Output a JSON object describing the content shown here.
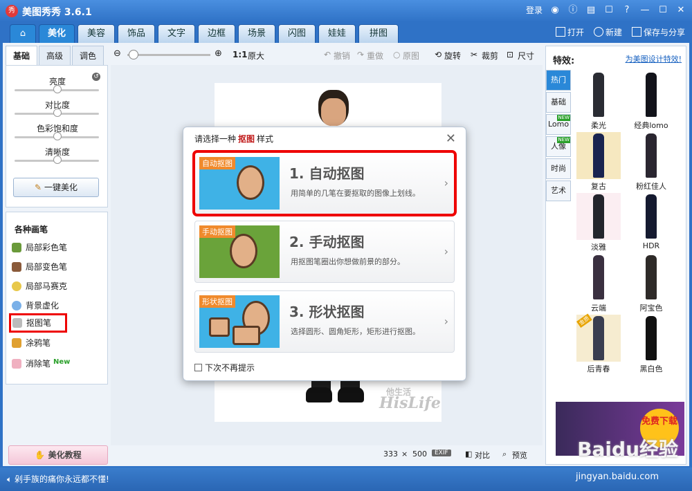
{
  "app": {
    "title": "美图秀秀 3.6.1",
    "logo_text": "秀"
  },
  "titlebar": {
    "login": "登录"
  },
  "tabs": [
    "美化",
    "美容",
    "饰品",
    "文字",
    "边框",
    "场景",
    "闪图",
    "娃娃",
    "拼图"
  ],
  "tab_actions": {
    "open": "打开",
    "new": "新建",
    "save": "保存与分享"
  },
  "left": {
    "subtabs": [
      "基础",
      "高级",
      "调色"
    ],
    "sliders": [
      {
        "label": "亮度",
        "value": 0.5
      },
      {
        "label": "对比度",
        "value": 0.5
      },
      {
        "label": "色彩饱和度",
        "value": 0.5
      },
      {
        "label": "清晰度",
        "value": 0.5
      }
    ],
    "oneclick": "一键美化",
    "brush_title": "各种画笔",
    "brushes": [
      "局部彩色笔",
      "局部变色笔",
      "局部马赛克",
      "背景虚化",
      "抠图笔",
      "涂鸦笔",
      "消除笔"
    ],
    "brush_new": "New",
    "tutorial": "美化教程"
  },
  "canvas_toolbar": {
    "ratio": "1:1",
    "original_size": "原大",
    "undo": "撤销",
    "redo": "重做",
    "original": "原图",
    "rotate": "旋转",
    "crop": "裁剪",
    "size": "尺寸"
  },
  "canvas": {
    "watermark_small": "他生活",
    "watermark": "HisLife"
  },
  "canvas_status": {
    "width": "333",
    "times": "×",
    "height": "500",
    "exif": "EXIF",
    "compare": "对比",
    "preview": "预览"
  },
  "dialog": {
    "title_prefix": "请选择一种",
    "title_highlight": "抠图",
    "title_suffix": "样式",
    "options": [
      {
        "badge": "自动抠图",
        "heading": "1. 自动抠图",
        "desc": "用简单的几笔在要抠取的图像上划线。"
      },
      {
        "badge": "手动抠图",
        "heading": "2. 手动抠图",
        "desc": "用抠图笔圈出你想做前景的部分。"
      },
      {
        "badge": "形状抠图",
        "heading": "3. 形状抠图",
        "desc": "选择圆形、圆角矩形，矩形进行抠图。"
      }
    ],
    "checkbox": "下次不再提示"
  },
  "right": {
    "title": "特效:",
    "link": "为美图设计特效!",
    "tabs": [
      "热门",
      "基础",
      "Lomo",
      "人像",
      "时尚",
      "艺术"
    ],
    "tab_new": "NEW",
    "effects": [
      "柔光",
      "经典lomo",
      "复古",
      "粉红佳人",
      "淡雅",
      "HDR",
      "云端",
      "阿宝色",
      "后青春",
      "黑白色"
    ],
    "hot_badge": "金质",
    "ad_text": "免费下载"
  },
  "status": {
    "text": "剁手族的痛你永远都不懂!"
  },
  "overlay": {
    "baidu": "Baidu经验",
    "url": "jingyan.baidu.com"
  },
  "colors": {
    "accent": "#2a88d8",
    "highlight": "#e00000"
  }
}
